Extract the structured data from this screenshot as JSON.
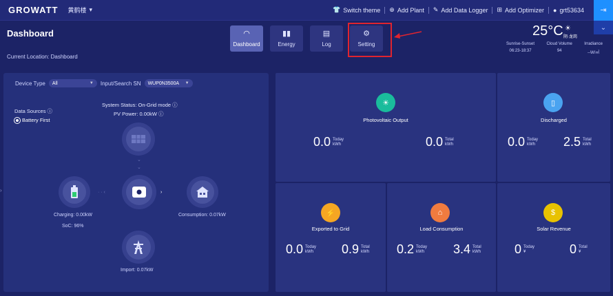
{
  "header": {
    "logo": "GROWATT",
    "plant": "黄鹤楼",
    "links": [
      "Switch theme",
      "Add Plant",
      "Add Data Logger",
      "Add Optimizer"
    ],
    "user": "grt53634"
  },
  "page": {
    "title": "Dashboard",
    "location": "Current Location: Dashboard"
  },
  "nav": {
    "tabs": [
      {
        "label": "Dashboard",
        "icon": "gauge-icon",
        "active": true
      },
      {
        "label": "Energy",
        "icon": "bar-chart-icon",
        "active": false
      },
      {
        "label": "Log",
        "icon": "log-icon",
        "active": false
      },
      {
        "label": "Setting",
        "icon": "gear-icon",
        "active": false
      }
    ]
  },
  "weather": {
    "temp": "25°C",
    "desc": "阴·龙岗",
    "stats": [
      {
        "label": "Sunrise-Sunset",
        "value": "06:23-18:37"
      },
      {
        "label": "Cloud Volume",
        "value": "94"
      },
      {
        "label": "Irradiance",
        "value": "--W/㎡"
      }
    ]
  },
  "device": {
    "type_label": "Device Type",
    "type_value": "All",
    "sn_label": "Input/Search SN",
    "sn_value": "WUP0N3500A",
    "status": "System Status:  On-Grid mode ⓘ",
    "pv_power": "PV Power:  0.00kW ⓘ",
    "data_sources": "Data Sources ⓘ",
    "battery_first": "Battery First",
    "charging": "Charging:  0.00kW",
    "soc": "SoC:  96%",
    "consumption": "Consumption:  0.07kW",
    "import": "Import:  0.07kW"
  },
  "cards": {
    "pv": {
      "title": "Photovoltaic Output",
      "today": "0.0",
      "total": "0.0",
      "today_label": "Today",
      "total_label": "Total",
      "unit": "kWh",
      "color": "#1abc9c"
    },
    "discharged": {
      "title": "Discharged",
      "today": "0.0",
      "total": "2.5",
      "today_label": "Today",
      "total_label": "Total",
      "unit": "kWh",
      "color": "#4aa3f0"
    },
    "exported": {
      "title": "Exported to Grid",
      "today": "0.0",
      "total": "0.9",
      "today_label": "Today",
      "total_label": "Total",
      "unit": "kWh",
      "color": "#f5a623"
    },
    "load": {
      "title": "Load Consumption",
      "today": "0.2",
      "total": "3.4",
      "today_label": "Today",
      "total_label": "Total",
      "unit": "kWh",
      "color": "#f07b3f"
    },
    "revenue": {
      "title": "Solar Revenue",
      "today": "0",
      "total": "0",
      "today_label": "Today",
      "total_label": "Total",
      "unit": "¥",
      "color": "#e8c200"
    }
  }
}
